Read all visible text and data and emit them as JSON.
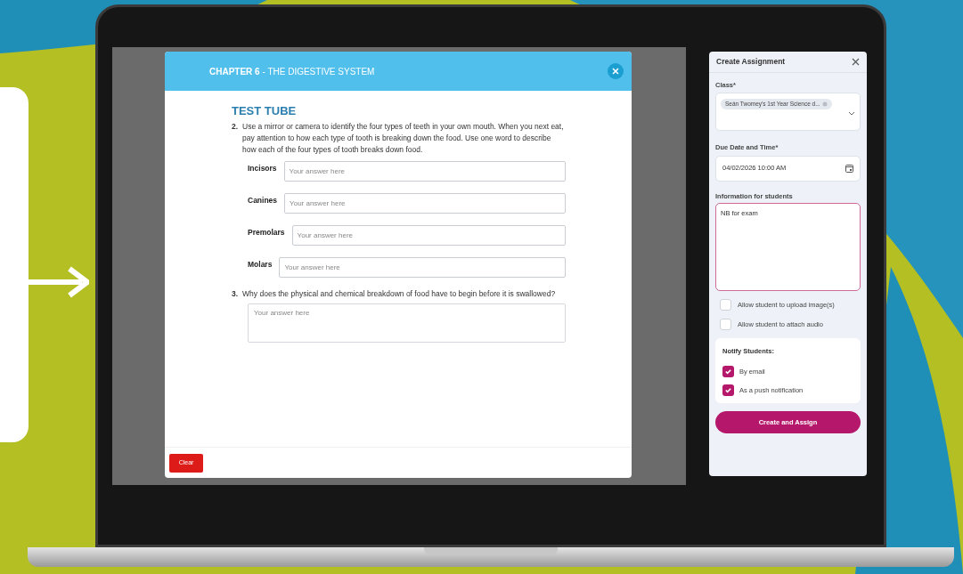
{
  "modal": {
    "chapter": "CHAPTER 6",
    "chapter_title": "- THE DIGESTIVE SYSTEM",
    "heading": "TEST TUBE",
    "questions": [
      {
        "number": "2.",
        "text": "Use a mirror or camera to identify the four types of teeth in your own mouth. When you next eat, pay attention to how each type of tooth is breaking down the food. Use one word to describe how each of the four types of tooth breaks down food.",
        "answers": [
          {
            "label": "Incisors",
            "placeholder": "Your answer here"
          },
          {
            "label": "Canines",
            "placeholder": "Your answer here"
          },
          {
            "label": "Premolars",
            "placeholder": "Your answer here"
          },
          {
            "label": "Molars",
            "placeholder": "Your answer here"
          }
        ]
      },
      {
        "number": "3.",
        "text": "Why does the physical and chemical breakdown of food have to begin before it is swallowed?",
        "answer_placeholder": "Your answer here"
      }
    ],
    "clear_button": "Clear"
  },
  "panel": {
    "title": "Create Assignment",
    "class_label": "Class*",
    "class_chip": "Seán Twomey's 1st Year Science d...",
    "due_label": "Due Date and Time*",
    "due_value": "04/02/2026 10:00 AM",
    "info_label": "Information for students",
    "info_value": "NB for exam",
    "options": [
      {
        "label": "Allow student to upload image(s)",
        "checked": false
      },
      {
        "label": "Allow student to attach audio",
        "checked": false
      }
    ],
    "notify": {
      "title": "Notify Students:",
      "options": [
        {
          "label": "By email",
          "checked": true
        },
        {
          "label": "As a push notification",
          "checked": true
        }
      ]
    },
    "submit": "Create and Assign"
  }
}
